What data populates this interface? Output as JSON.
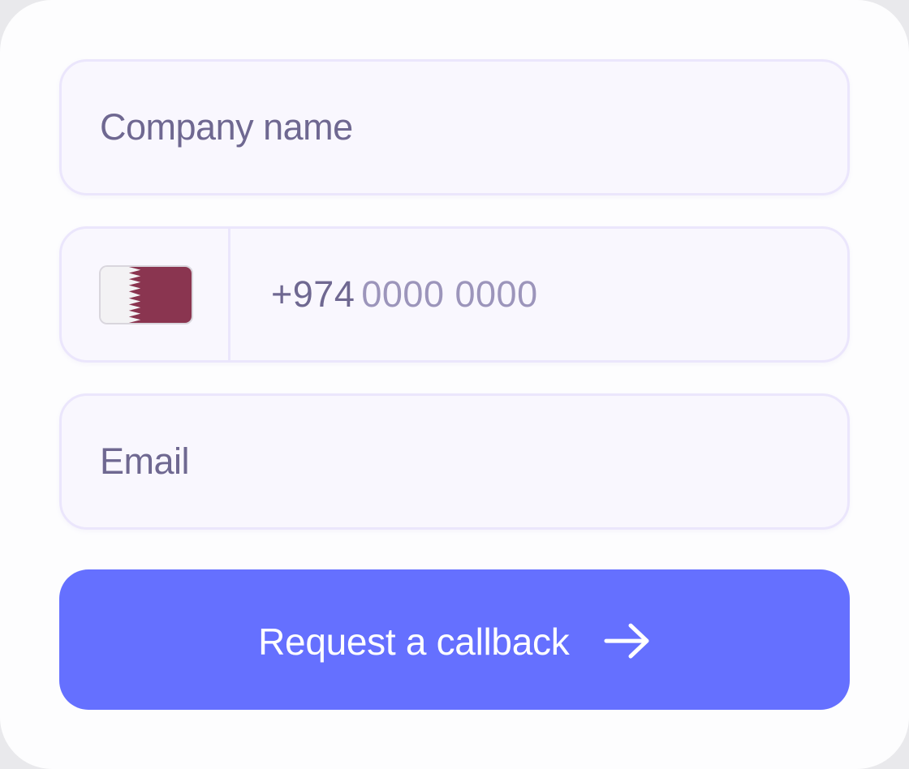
{
  "form": {
    "company_field": {
      "placeholder": "Company name"
    },
    "phone_field": {
      "country_flag_icon": "qatar-flag-icon",
      "country_code": "+974",
      "placeholder": "0000 0000"
    },
    "email_field": {
      "placeholder": "Email"
    },
    "submit_button": {
      "label": "Request a callback",
      "icon": "arrow-right-icon"
    }
  },
  "colors": {
    "accent": "#6570ff",
    "field_background": "#f9f7fe",
    "field_border": "#ebe6fc",
    "text": "#6f6891",
    "placeholder": "#9c95bb",
    "qatar_maroon": "#8a3550"
  }
}
